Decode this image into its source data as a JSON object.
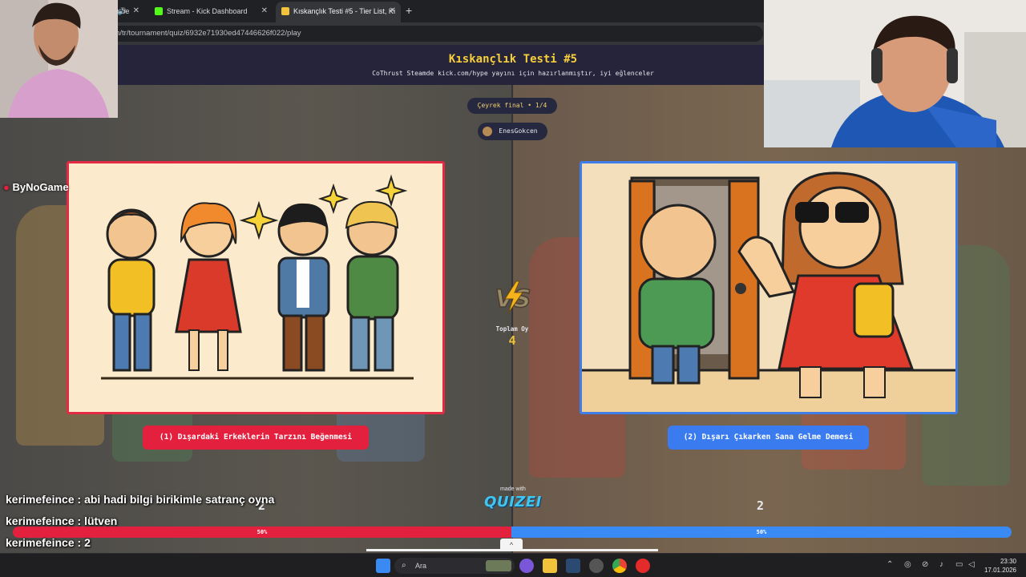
{
  "browser": {
    "tabs": [
      {
        "label": "YouTube",
        "favicon_color": "#ff0000"
      },
      {
        "label": "Stream - Kick Dashboard",
        "favicon_color": "#53fc18"
      },
      {
        "label": "Kıskançlık Testi #5 - Tier List, Kı",
        "favicon_color": "#f2c33a"
      }
    ],
    "url": "quizei.com/tr/tournament/quiz/6932e71930ed47446626f022/play",
    "new_tab_symbol": "+"
  },
  "quiz": {
    "title": "Kıskançlık Testi #5",
    "subtitle": "CoThrust Steamde kick.com/hype yayını için hazırlanmıştır, iyi eğlenceler",
    "round": "Çeyrek final • 1/4",
    "author": "EnesGokcen",
    "total_label": "Toplam Oy",
    "total_value": "4",
    "vs_text": "VS",
    "option_left": {
      "label": "(1) Dışardaki Erkeklerin Tarzını Beğenmesi",
      "votes": "2",
      "percent": "50%",
      "color": "#e3213f"
    },
    "option_right": {
      "label": "(2) Dışarı Çıkarken Sana Gelme Demesi",
      "votes": "2",
      "percent": "50%",
      "color": "#3a8af5"
    },
    "made_with": "made with",
    "brand": "QUIZEI"
  },
  "overlay": {
    "sponsor": "ByNoGame",
    "chat": [
      {
        "user": "kerimefeince",
        "message": "abi hadi bilgi birikimle satranç oyna"
      },
      {
        "user": "kerimefeince",
        "message": "lütven"
      },
      {
        "user": "kerimefeince",
        "message": "2"
      }
    ]
  },
  "taskbar": {
    "search_placeholder": "Ara",
    "time": "23:30",
    "date": "17.01.2026"
  }
}
